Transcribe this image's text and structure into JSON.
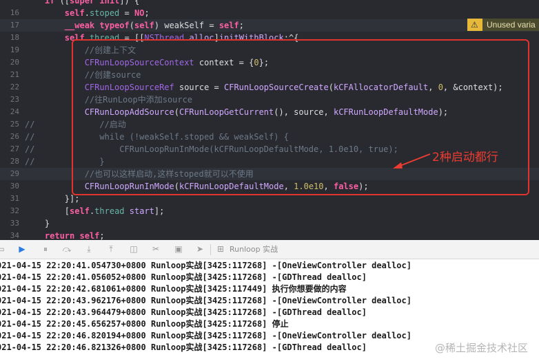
{
  "editor": {
    "lines": [
      {
        "num": "",
        "text": "    if ([super init]) {"
      },
      {
        "num": "16",
        "text": "        self.stoped = NO;"
      },
      {
        "num": "17",
        "text": "        __weak typeof(self) weakSelf = self;"
      },
      {
        "num": "18",
        "text": "        self.thread = [[NSThread alloc]initWithBlock:^{"
      },
      {
        "num": "19",
        "text": "            //创建上下文"
      },
      {
        "num": "20",
        "text": "            CFRunLoopSourceContext context = {0};"
      },
      {
        "num": "21",
        "text": "            //创建source"
      },
      {
        "num": "22",
        "text": "            CFRunLoopSourceRef source = CFRunLoopSourceCreate(kCFAllocatorDefault, 0, &context);"
      },
      {
        "num": "23",
        "text": "            //往RunLoop中添加source"
      },
      {
        "num": "24",
        "text": "            CFRunLoopAddSource(CFRunLoopGetCurrent(), source, kCFRunLoopDefaultMode);"
      },
      {
        "num": "25",
        "text": "//             //启动"
      },
      {
        "num": "26",
        "text": "//             while (!weakSelf.stoped && weakSelf) {"
      },
      {
        "num": "27",
        "text": "//                 CFRunLoopRunInMode(kCFRunLoopDefaultMode, 1.0e10, true);"
      },
      {
        "num": "28",
        "text": "//             }"
      },
      {
        "num": "29",
        "text": "            //也可以这样启动,这样stoped就可以不使用"
      },
      {
        "num": "30",
        "text": "            CFRunLoopRunInMode(kCFRunLoopDefaultMode, 1.0e10, false);"
      },
      {
        "num": "31",
        "text": "        }];"
      },
      {
        "num": "32",
        "text": "        [self.thread start];"
      },
      {
        "num": "33",
        "text": "    }"
      },
      {
        "num": "34",
        "text": "    return self;"
      },
      {
        "num": "35",
        "text": "}"
      }
    ],
    "warning_text": "Unused varia",
    "annotation": "2种启动都行"
  },
  "debug_bar": {
    "target_label": "Runloop 实战"
  },
  "console": {
    "lines": [
      "021-04-15 22:20:41.054730+0800 Runloop实战[3425:117268] -[OneViewController dealloc]",
      "021-04-15 22:20:41.056052+0800 Runloop实战[3425:117268] -[GDThread dealloc]",
      "021-04-15 22:20:42.681061+0800 Runloop实战[3425:117449] 执行你想要做的内容",
      "021-04-15 22:20:43.962176+0800 Runloop实战[3425:117268] -[OneViewController dealloc]",
      "021-04-15 22:20:43.964479+0800 Runloop实战[3425:117268] -[GDThread dealloc]",
      "021-04-15 22:20:45.656257+0800 Runloop实战[3425:117268] 停止",
      "021-04-15 22:20:46.820194+0800 Runloop实战[3425:117268] -[OneViewController dealloc]",
      "021-04-15 22:20:46.821326+0800 Runloop实战[3425:117268] -[GDThread dealloc]"
    ],
    "watermark": "@稀土掘金技术社区"
  },
  "colors": {
    "editor_bg": "#292a30",
    "keyword": "#fc5fa3",
    "comment": "#6c7986",
    "type": "#d0a8ff",
    "function": "#67b7a4",
    "number": "#d0bf69",
    "annotation_red": "#e2332c",
    "warning_yellow": "#e6b93a"
  },
  "icons": [
    "warning-icon",
    "breakpoint-icon",
    "pause-icon",
    "step-over-icon",
    "step-into-icon",
    "step-out-icon",
    "view-debugger-icon",
    "memory-graph-icon",
    "environment-icon",
    "location-icon",
    "target-icon"
  ]
}
